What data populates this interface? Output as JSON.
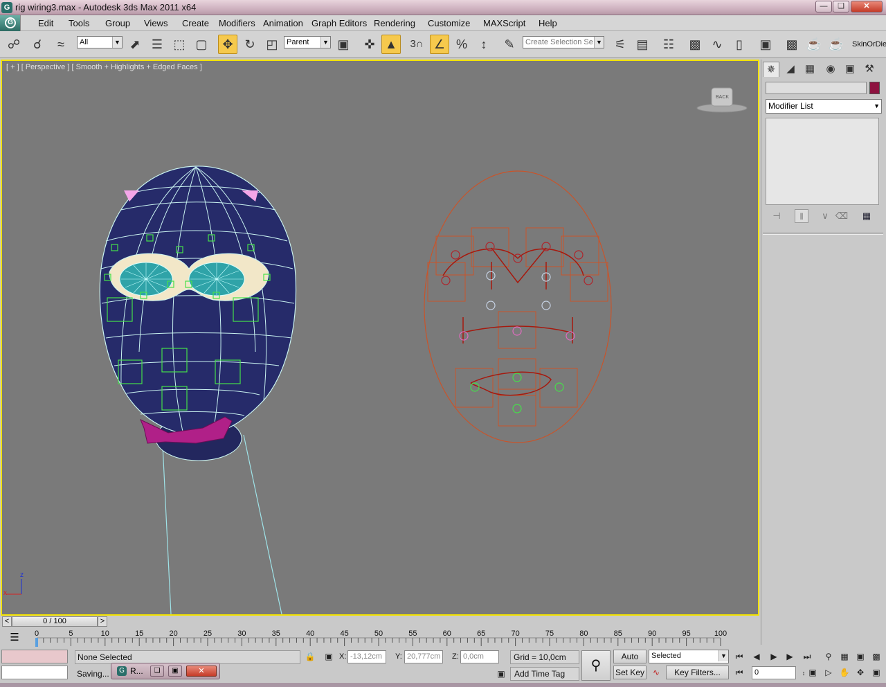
{
  "window": {
    "title": "rig wiring3.max - Autodesk 3ds Max  2011 x64",
    "minimize": "—",
    "restore": "❏",
    "close": "✕"
  },
  "menu": {
    "items": [
      "Edit",
      "Tools",
      "Group",
      "Views",
      "Create",
      "Modifiers",
      "Animation",
      "Graph Editors",
      "Rendering",
      "Customize",
      "MAXScript",
      "Help"
    ]
  },
  "toolbar": {
    "selection_filter": "All",
    "coordinate_system": "Parent",
    "snap_value": "3",
    "named_selection_placeholder": "Create Selection Se",
    "plugin_label": "SkinOrDie"
  },
  "viewport": {
    "label": "[ + ] [ Perspective ] [ Smooth + Highlights + Edged Faces ]",
    "viewcube_label": "BACK",
    "axis_z": "z",
    "axis_x": "x",
    "active_border_color": "#f2e200",
    "background_color": "#7a7a7a"
  },
  "command_panel": {
    "modifier_list": "Modifier List",
    "object_color": "#8e1240"
  },
  "time": {
    "current_display": "0 / 100",
    "ticks": [
      0,
      5,
      10,
      15,
      20,
      25,
      30,
      35,
      40,
      45,
      50,
      55,
      60,
      65,
      70,
      75,
      80,
      85,
      90,
      95,
      100
    ]
  },
  "status": {
    "selection_text": "None Selected",
    "prompt_text": "Saving...",
    "x_label": "X:",
    "x_value": "-13,12cm",
    "y_label": "Y:",
    "y_value": "20,777cm",
    "z_label": "Z:",
    "z_value": "0,0cm",
    "grid": "Grid = 10,0cm",
    "add_time_tag": "Add Time Tag",
    "auto_key": "Auto Key",
    "set_key": "Set Key",
    "key_mode": "Selected",
    "key_filters": "Key Filters...",
    "current_frame": "0",
    "taskbar_item": "R..."
  }
}
